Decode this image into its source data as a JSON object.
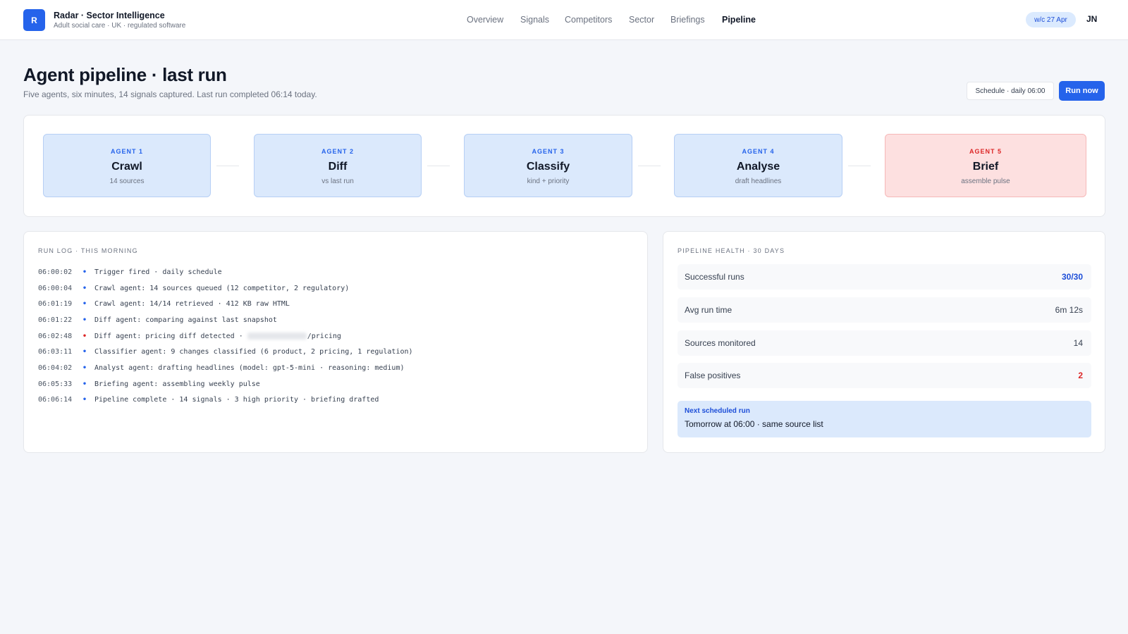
{
  "app": {
    "logo_letter": "R",
    "title": "Radar · Sector Intelligence",
    "subtitle": "Adult social care · UK · regulated software"
  },
  "nav": {
    "items": [
      {
        "label": "Overview",
        "active": false
      },
      {
        "label": "Signals",
        "active": false
      },
      {
        "label": "Competitors",
        "active": false
      },
      {
        "label": "Sector",
        "active": false
      },
      {
        "label": "Briefings",
        "active": false
      },
      {
        "label": "Pipeline",
        "active": true
      }
    ]
  },
  "header_right": {
    "week_badge": "w/c 27 Apr",
    "user_initials": "JN"
  },
  "page": {
    "title": "Agent pipeline · last run",
    "subtitle": "Five agents, six minutes, 14 signals captured. Last run completed 06:14 today.",
    "schedule_label": "Schedule · daily 06:00",
    "run_now_label": "Run now"
  },
  "agents": [
    {
      "number": "AGENT 1",
      "name": "Crawl",
      "detail": "14 sources",
      "status": "ok"
    },
    {
      "number": "AGENT 2",
      "name": "Diff",
      "detail": "vs last run",
      "status": "ok"
    },
    {
      "number": "AGENT 3",
      "name": "Classify",
      "detail": "kind + priority",
      "status": "ok"
    },
    {
      "number": "AGENT 4",
      "name": "Analyse",
      "detail": "draft headlines",
      "status": "ok"
    },
    {
      "number": "AGENT 5",
      "name": "Brief",
      "detail": "assemble pulse",
      "status": "alert"
    }
  ],
  "run_log": {
    "label": "RUN LOG · THIS MORNING",
    "entries": [
      {
        "time": "06:00:02",
        "dot": "•",
        "dot_color": "blue",
        "text": "Trigger fired · daily schedule"
      },
      {
        "time": "06:00:04",
        "dot": "•",
        "dot_color": "blue",
        "text": "Crawl agent: 14 sources queued (12 competitor, 2 regulatory)"
      },
      {
        "time": "06:01:19",
        "dot": "•",
        "dot_color": "blue",
        "text": "Crawl agent: 14/14 retrieved · 412 KB raw HTML"
      },
      {
        "time": "06:01:22",
        "dot": "•",
        "dot_color": "blue",
        "text": "Diff agent: comparing against last snapshot"
      },
      {
        "time": "06:02:48",
        "dot": "•",
        "dot_color": "red",
        "text": "Diff agent: pricing diff detected · ",
        "redacted": true,
        "suffix": "/pricing"
      },
      {
        "time": "06:03:11",
        "dot": "•",
        "dot_color": "blue",
        "text": "Classifier agent: 9 changes classified (6 product, 2 pricing, 1 regulation)"
      },
      {
        "time": "06:04:02",
        "dot": "•",
        "dot_color": "blue",
        "text": "Analyst agent: drafting headlines (model: gpt-5-mini · reasoning: medium)"
      },
      {
        "time": "06:05:33",
        "dot": "•",
        "dot_color": "blue",
        "text": "Briefing agent: assembling weekly pulse"
      },
      {
        "time": "06:06:14",
        "dot": "•",
        "dot_color": "blue",
        "text": "Pipeline complete · 14 signals · 3 high priority · briefing drafted"
      }
    ]
  },
  "health": {
    "label": "PIPELINE HEALTH · 30 DAYS",
    "rows": [
      {
        "label": "Successful runs",
        "value": "30/30",
        "tone": "blue"
      },
      {
        "label": "Avg run time",
        "value": "6m 12s",
        "tone": "neutral"
      },
      {
        "label": "Sources monitored",
        "value": "14",
        "tone": "neutral"
      },
      {
        "label": "False positives",
        "value": "2",
        "tone": "red"
      }
    ],
    "next_run": {
      "label": "Next scheduled run",
      "text": "Tomorrow at 06:00 · same source list"
    }
  },
  "colors": {
    "accent": "#2563eb",
    "agent_ok_bg": "#dbe9fc",
    "agent_alert_bg": "#fde0e0",
    "alert": "#dc2626"
  }
}
